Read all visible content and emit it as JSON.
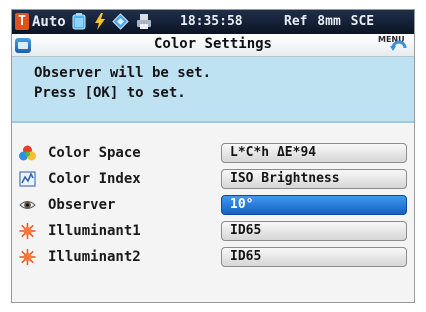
{
  "statusbar": {
    "mode": "Auto",
    "time": "18:35:58",
    "conditions": "Ref 8mm SCE"
  },
  "title": "Color Settings",
  "menu_label": "MENU",
  "message": {
    "line1": "Observer will be set.",
    "line2": "Press [OK] to set."
  },
  "settings": [
    {
      "label": "Color Space",
      "value": "L*C*h ΔE*94",
      "icon": "color-space-icon"
    },
    {
      "label": "Color Index",
      "value": "ISO Brightness",
      "icon": "color-index-icon"
    },
    {
      "label": "Observer",
      "value": "10°",
      "icon": "observer-eye-icon",
      "selected": true
    },
    {
      "label": "Illuminant1",
      "value": "ID65",
      "icon": "illuminant-sun-icon"
    },
    {
      "label": "Illuminant2",
      "value": "ID65",
      "icon": "illuminant-sun-icon"
    }
  ],
  "colors": {
    "selected_field": "#2e7fe0",
    "message_panel": "#bfe2f3",
    "status_bar": "#101b30",
    "illuminant_icon": "#f05a2a"
  }
}
